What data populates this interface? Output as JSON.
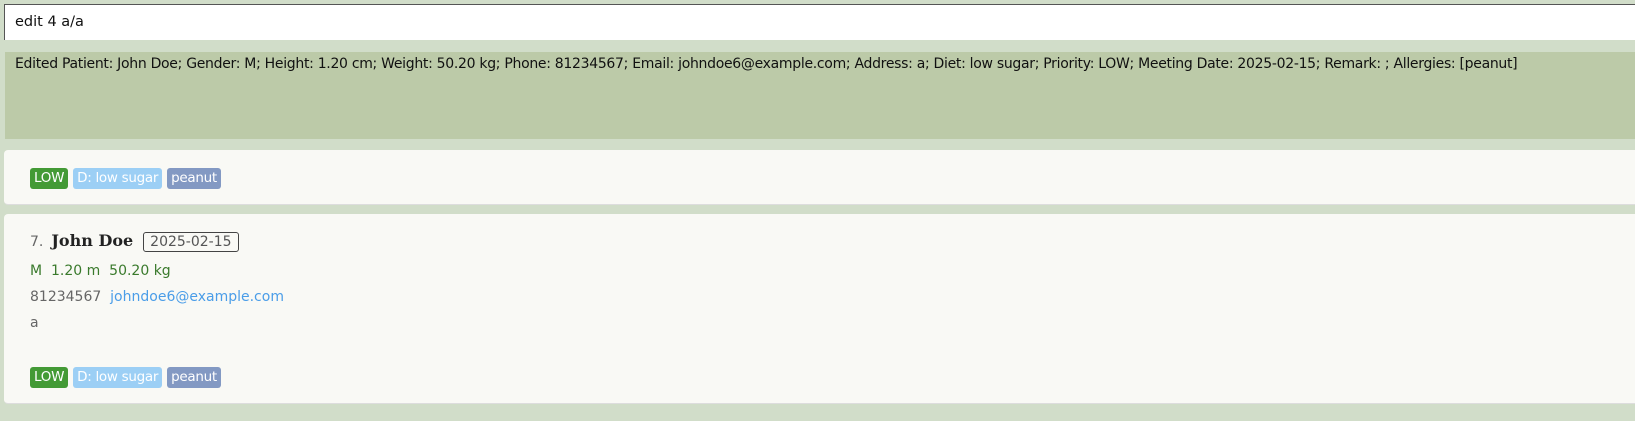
{
  "command": {
    "value": "edit 4 a/a"
  },
  "result": {
    "message": "Edited Patient: John Doe; Gender: M; Height: 1.20 cm; Weight: 50.20 kg; Phone: 81234567; Email: johndoe6@example.com; Address: a; Diet: low sugar; Priority: LOW; Meeting Date: 2025-02-15; Remark: ; Allergies: [peanut]"
  },
  "colors": {
    "priority": "#439a35",
    "diet": "#9ccff5",
    "allergy": "#8399c3",
    "physical": "#3a7a2c",
    "email": "#4a9de8"
  },
  "cards": [
    {
      "tags": {
        "priority": "LOW",
        "diet": "D: low sugar",
        "allergy": "peanut"
      }
    },
    {
      "index": "7.",
      "name": "John Doe",
      "date": "2025-02-15",
      "gender": "M",
      "height": "1.20 m",
      "weight": "50.20 kg",
      "phone": "81234567",
      "email": "johndoe6@example.com",
      "address": "a",
      "tags": {
        "priority": "LOW",
        "diet": "D: low sugar",
        "allergy": "peanut"
      }
    }
  ]
}
